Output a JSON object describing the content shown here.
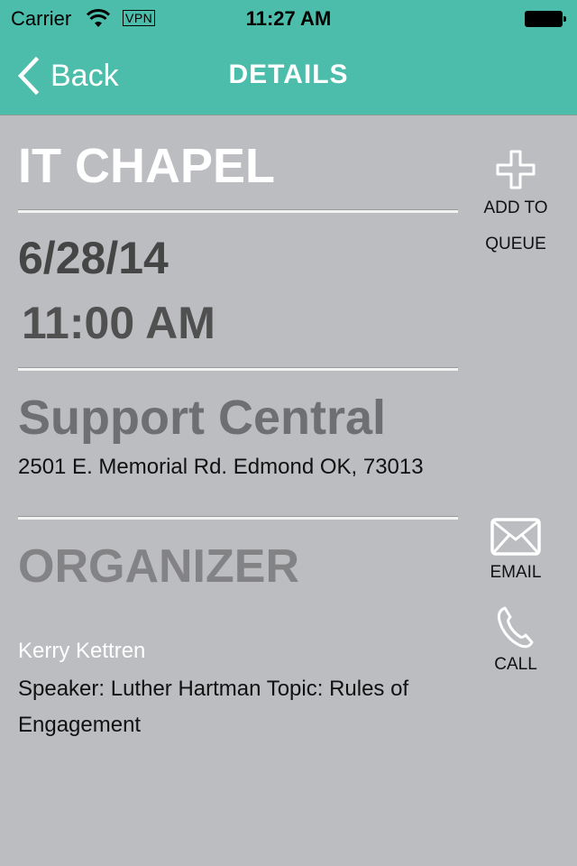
{
  "status_bar": {
    "carrier": "Carrier",
    "vpn_label": "VPN",
    "time": "11:27 AM",
    "icons": [
      "wifi-icon",
      "battery-icon"
    ]
  },
  "nav_bar": {
    "back_label": "Back",
    "title": "DETAILS",
    "color": "#4bbdaa"
  },
  "event": {
    "title": "IT CHAPEL",
    "date": "6/28/14",
    "time": "11:00 AM",
    "venue": "Support Central",
    "address": "2501 E. Memorial Rd. Edmond OK, 73013",
    "organizer_heading": "ORGANIZER",
    "organizer_name": "Kerry Kettren",
    "description": "Speaker: Luther Hartman Topic: Rules of Engagement"
  },
  "actions": {
    "add_to_queue": {
      "label_line1": "ADD TO",
      "label_line2": "QUEUE",
      "icon": "plus-icon"
    },
    "email": {
      "label": "EMAIL",
      "icon": "envelope-icon"
    },
    "call": {
      "label": "CALL",
      "icon": "phone-icon"
    }
  }
}
